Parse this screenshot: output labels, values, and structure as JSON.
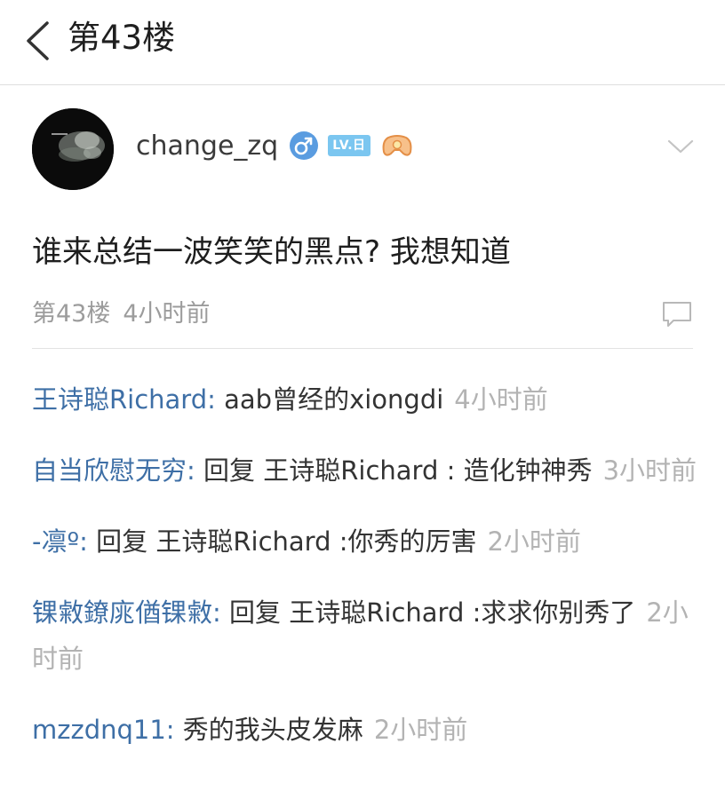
{
  "header": {
    "title": "第43楼"
  },
  "post": {
    "author": "change_zq",
    "level_badge": "LV.日",
    "text": "谁来总结一波笑笑的黑点? 我想知道",
    "floor": "第43楼",
    "time": "4小时前"
  },
  "icons": {
    "back": "back-chevron-icon",
    "gender": "male-gender-icon",
    "game_badge": "gamepad-badge-icon",
    "more": "chevron-down-icon",
    "reply": "comment-bubble-icon"
  },
  "colors": {
    "username_blue": "#3e6fa6",
    "time_gray": "#b3b3b3",
    "gender_blue": "#5a9ce0",
    "level_badge_bg": "#7bc6f0",
    "gamepad_orange": "#f0a75f"
  },
  "comments": [
    {
      "user": "王诗聪Richard",
      "sep": ": ",
      "text": "aab曾经的xiongdi",
      "time": "4小时前"
    },
    {
      "user": "自当欣慰无穷",
      "sep": ": ",
      "text": "回复 王诗聪Richard : 造化钟神秀",
      "time": "3小时前"
    },
    {
      "user": "-凛º",
      "sep": ": ",
      "text": "回复 王诗聪Richard :你秀的厉害",
      "time": "2小时前"
    },
    {
      "user": "锞敹鐐庣偤锞敹",
      "sep": ": ",
      "text": "回复 王诗聪Richard :求求你别秀了",
      "time": "2小时前"
    },
    {
      "user": "mzzdnq11",
      "sep": ": ",
      "text": "秀的我头皮发麻",
      "time": "2小时前"
    }
  ]
}
